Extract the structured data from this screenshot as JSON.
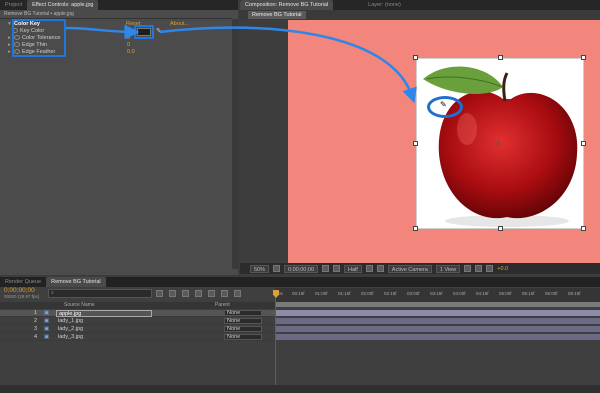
{
  "effects_panel": {
    "tab_project": "Project",
    "tab_effect_controls": "Effect Controls: apple.jpg",
    "breadcrumb": "Remove BG Tutorial • apple.jpg",
    "effect_name": "Color Key",
    "reset_label": "Reset",
    "about_label": "About...",
    "properties": [
      {
        "label": "Key Color",
        "value": ""
      },
      {
        "label": "Color Tolerance",
        "value": "0"
      },
      {
        "label": "Edge Thin",
        "value": "0"
      },
      {
        "label": "Edge Feather",
        "value": "0.0"
      }
    ]
  },
  "composition_panel": {
    "tab_composition": "Composition: Remove BG Tutorial",
    "tab_layer": "Layer: (none)",
    "comp_name_tab": "Remove BG Tutorial",
    "background_color": "#f2857c",
    "toolbar": {
      "zoom": "50%",
      "timecode": "0;00;00;00",
      "resolution": "Half",
      "camera": "Active Camera",
      "view": "1 View",
      "exposure": "+0.0"
    }
  },
  "timeline_panel": {
    "tab_render": "Render Queue",
    "tab_comp": "Remove BG Tutorial",
    "timecode": "0;00;00;00",
    "fps": "00000 (29.97 fps)",
    "search_placeholder": "",
    "col_source_name": "Source Name",
    "col_parent": "Parent",
    "ruler_labels": [
      "0s",
      "00:15f",
      "01:00f",
      "01:15f",
      "02:00f",
      "02:15f",
      "03:00f",
      "03:15f",
      "04:00f",
      "04:15f",
      "05:00f",
      "05:15f",
      "06:00f",
      "06:15f"
    ],
    "layers": [
      {
        "num": "1",
        "name": "apple.jpg",
        "parent": "None"
      },
      {
        "num": "2",
        "name": "lady_1.jpg",
        "parent": "None"
      },
      {
        "num": "3",
        "name": "lady_2.jpg",
        "parent": "None"
      },
      {
        "num": "4",
        "name": "lady_3.jpg",
        "parent": "None"
      }
    ]
  },
  "colors": {
    "accent": "#1e78dc",
    "value_text": "#d9a13a",
    "playhead": "#d03020",
    "layer_bar": "#6a6a86"
  }
}
